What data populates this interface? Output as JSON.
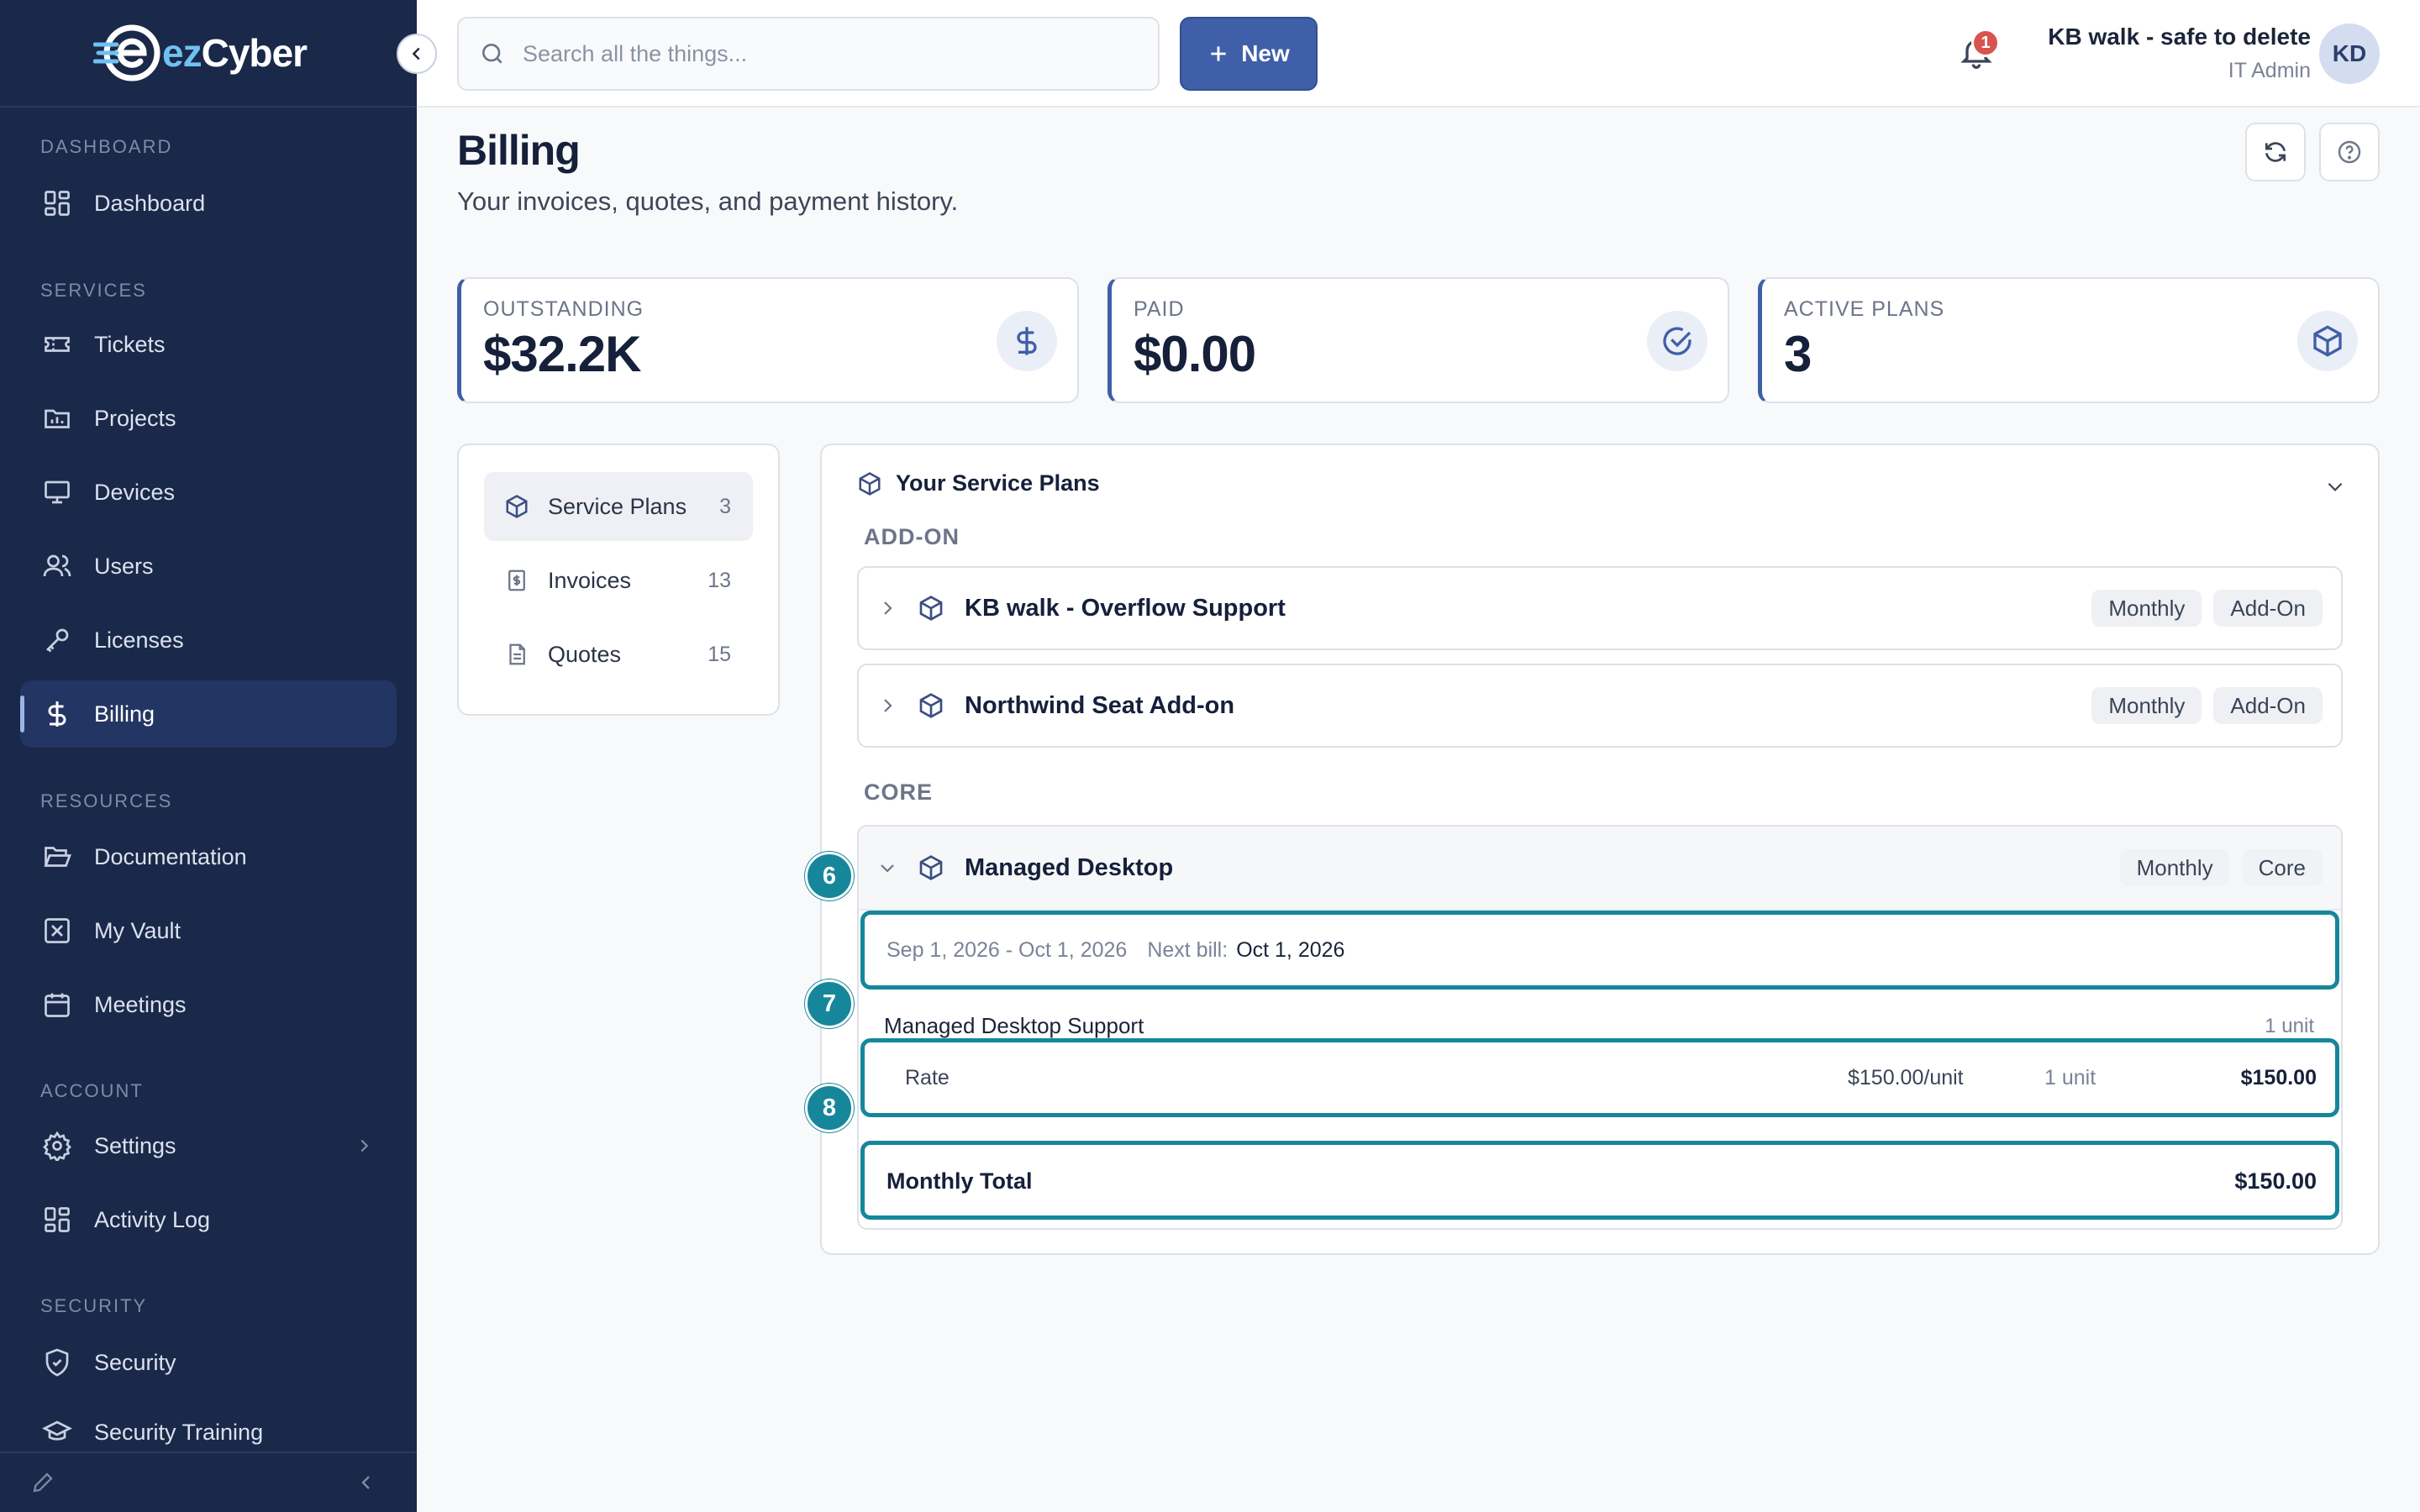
{
  "brand": {
    "logo_prefix": "ez",
    "logo_suffix": "Cyber"
  },
  "sidebar": {
    "sections": {
      "dashboard": "DASHBOARD",
      "services": "SERVICES",
      "resources": "RESOURCES",
      "account": "ACCOUNT",
      "security": "SECURITY"
    },
    "items": {
      "dashboard": "Dashboard",
      "tickets": "Tickets",
      "projects": "Projects",
      "devices": "Devices",
      "users": "Users",
      "licenses": "Licenses",
      "billing": "Billing",
      "documentation": "Documentation",
      "vault": "My Vault",
      "meetings": "Meetings",
      "settings": "Settings",
      "activity": "Activity Log",
      "security": "Security",
      "training": "Security Training"
    },
    "active": "billing"
  },
  "topbar": {
    "search_placeholder": "Search all the things...",
    "new_label": "New",
    "notification_count": "1",
    "user_name": "KB walk - safe to delete",
    "user_role": "IT Admin",
    "avatar_initials": "KD"
  },
  "page": {
    "title": "Billing",
    "subtitle": "Your invoices, quotes, and payment history."
  },
  "stats": {
    "outstanding": {
      "label": "OUTSTANDING",
      "value": "$32.2K"
    },
    "paid": {
      "label": "PAID",
      "value": "$0.00"
    },
    "active_plans": {
      "label": "ACTIVE PLANS",
      "value": "3"
    }
  },
  "tabs": {
    "service_plans": {
      "label": "Service Plans",
      "count": "3"
    },
    "invoices": {
      "label": "Invoices",
      "count": "13"
    },
    "quotes": {
      "label": "Quotes",
      "count": "15"
    }
  },
  "plans": {
    "header": "Your Service Plans",
    "addon_group": "ADD-ON",
    "core_group": "CORE",
    "addons": [
      {
        "name": "KB walk - Overflow Support",
        "frequency": "Monthly",
        "type": "Add-On"
      },
      {
        "name": "Northwind Seat Add-on",
        "frequency": "Monthly",
        "type": "Add-On"
      }
    ],
    "core": {
      "name": "Managed Desktop",
      "frequency": "Monthly",
      "type": "Core",
      "period": "Sep 1, 2026 - Oct 1, 2026",
      "next_bill_label": "Next bill:",
      "next_bill_date": "Oct 1, 2026",
      "line_item": "Managed Desktop Support",
      "line_units": "1 unit",
      "rate_label": "Rate",
      "rate_value": "$150.00/unit",
      "rate_units": "1 unit",
      "rate_total": "$150.00",
      "total_label": "Monthly Total",
      "total_value": "$150.00"
    }
  },
  "markers": {
    "m6": "6",
    "m7": "7",
    "m8": "8"
  },
  "colors": {
    "sidebar_bg": "#1a2849",
    "accent": "#3f5fa8",
    "highlight": "#16879a"
  }
}
